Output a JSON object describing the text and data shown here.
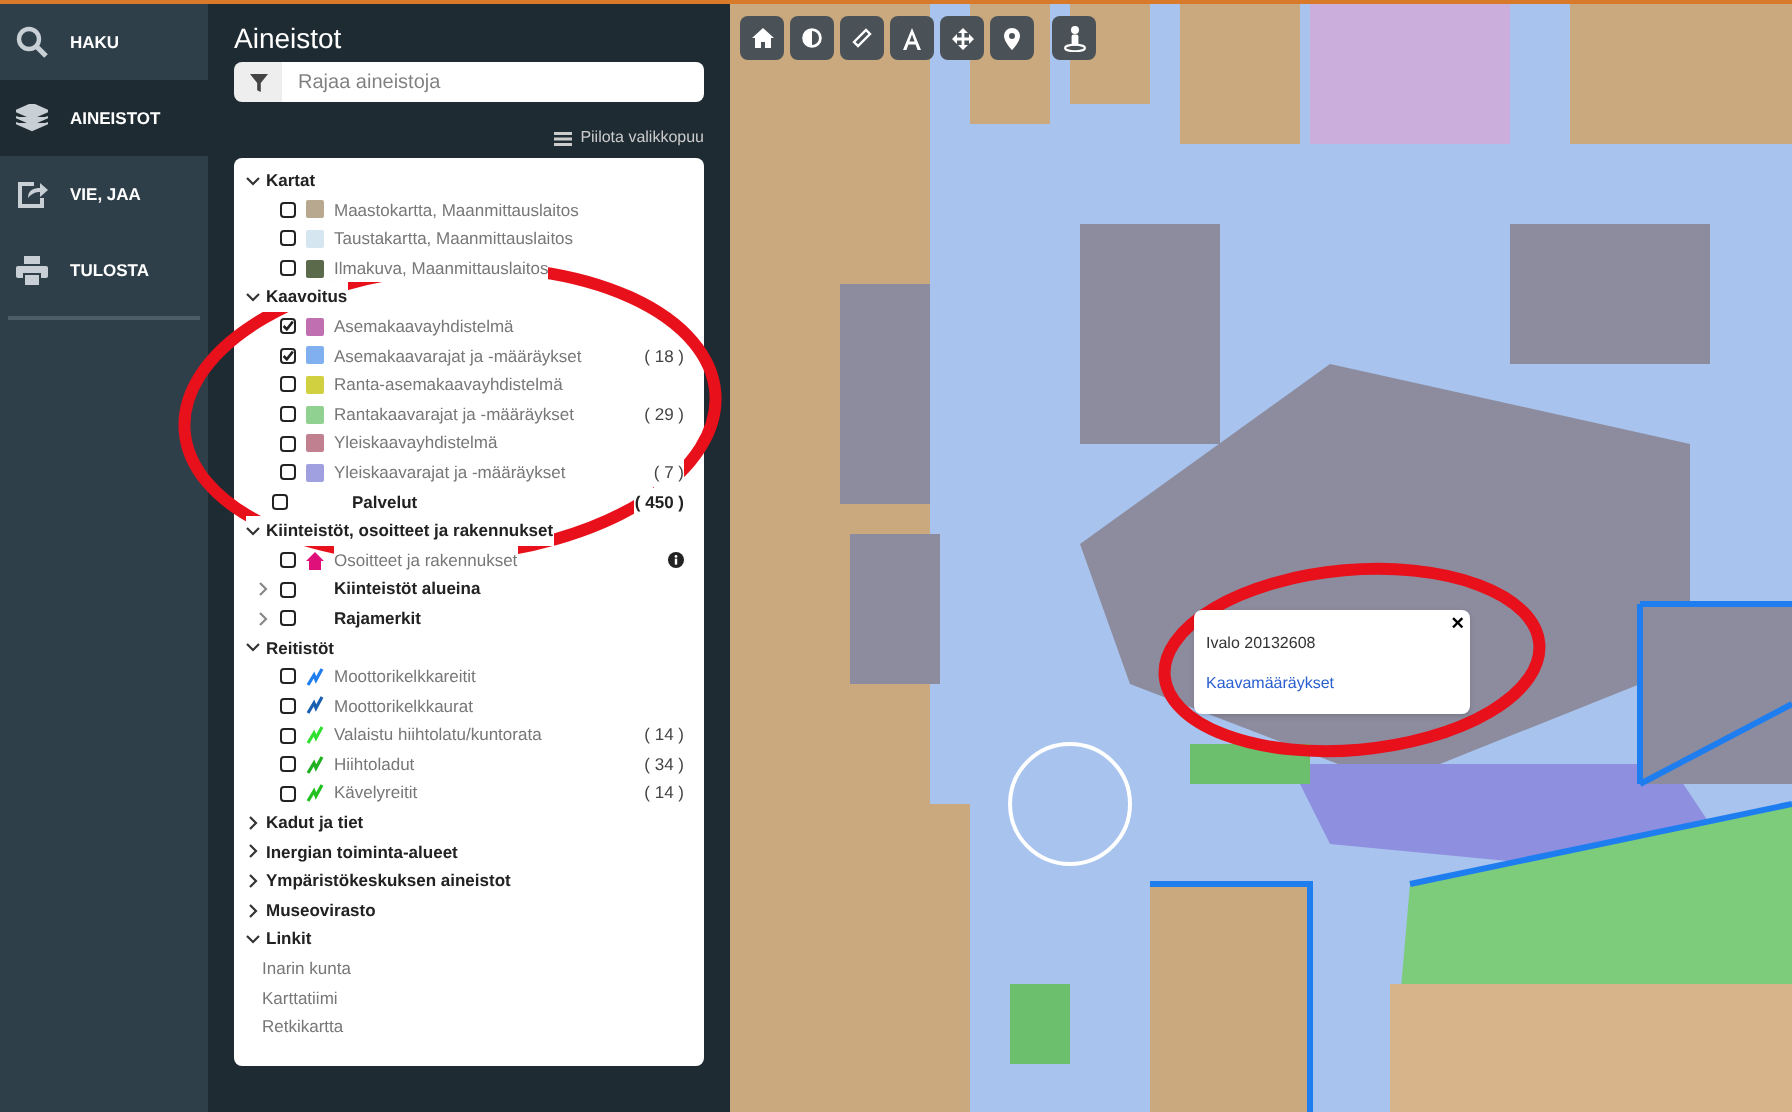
{
  "nav": [
    {
      "label": "HAKU",
      "selected": false
    },
    {
      "label": "AINEISTOT",
      "selected": true
    },
    {
      "label": "VIE, JAA",
      "selected": false
    },
    {
      "label": "TULOSTA",
      "selected": false
    }
  ],
  "panel": {
    "title": "Aineistot",
    "filter": {
      "placeholder": "Rajaa aineistoja"
    },
    "toggle": "Piilota valikkopuu"
  },
  "tree": [
    {
      "label": "Kartat",
      "expanded": true,
      "children": [
        {
          "kind": "layer",
          "label": "Maastokartta, Maanmittauslaitos",
          "checked": false,
          "color": "#b9a890"
        },
        {
          "kind": "layer",
          "label": "Taustakartta, Maanmittauslaitos",
          "checked": false,
          "color": "#d6e6f0"
        },
        {
          "kind": "layer",
          "label": "Ilmakuva, Maanmittauslaitos",
          "checked": false,
          "color": "#5a6a4a"
        }
      ]
    },
    {
      "label": "Kaavoitus",
      "expanded": true,
      "children": [
        {
          "kind": "layer",
          "label": "Asemakaavayhdistelmä",
          "checked": true,
          "color": "#c070b0"
        },
        {
          "kind": "layer",
          "label": "Asemakaavarajat ja -määräykset",
          "checked": true,
          "color": "#80b0f0",
          "count": "( 18 )"
        },
        {
          "kind": "layer",
          "label": "Ranta-asemakaavayhdistelmä",
          "checked": false,
          "color": "#d0d040"
        },
        {
          "kind": "layer",
          "label": "Rantakaavarajat ja -määräykset",
          "checked": false,
          "color": "#90d090",
          "count": "( 29 )"
        },
        {
          "kind": "layer",
          "label": "Yleiskaavayhdistelmä",
          "checked": false,
          "color": "#c08090"
        },
        {
          "kind": "layer",
          "label": "Yleiskaavarajat ja -määräykset",
          "checked": false,
          "color": "#a0a0e0",
          "count": "( 7 )"
        }
      ]
    },
    {
      "kind": "service",
      "label": "Palvelut",
      "checked": false,
      "count": "( 450 )"
    },
    {
      "label": "Kiinteistöt, osoitteet ja rakennukset",
      "expanded": true,
      "children": [
        {
          "kind": "layer",
          "label": "Osoitteet ja rakennukset",
          "checked": false,
          "color": "#e0107a",
          "info": true
        },
        {
          "kind": "subgroup",
          "label": "Kiinteistöt alueina",
          "checked": false,
          "expanded": false
        },
        {
          "kind": "subgroup",
          "label": "Rajamerkit",
          "checked": false,
          "expanded": false
        }
      ]
    },
    {
      "label": "Reitistöt",
      "expanded": true,
      "children": [
        {
          "kind": "route",
          "label": "Moottorikelkkareitit",
          "checked": false,
          "color": "#1e7ef0"
        },
        {
          "kind": "route",
          "label": "Moottorikelkkaurat",
          "checked": false,
          "color": "#1a5fb0"
        },
        {
          "kind": "route",
          "label": "Valaistu hiihtolatu/kuntorata",
          "checked": false,
          "color": "#30e030",
          "count": "( 14 )"
        },
        {
          "kind": "route",
          "label": "Hiihtoladut",
          "checked": false,
          "color": "#20b020",
          "count": "( 34 )"
        },
        {
          "kind": "route",
          "label": "Kävelyreitit",
          "checked": false,
          "color": "#20c020",
          "count": "( 14 )"
        }
      ]
    },
    {
      "label": "Kadut ja tiet",
      "expanded": false
    },
    {
      "label": "Inergian toiminta-alueet",
      "expanded": false
    },
    {
      "label": "Ympäristökeskuksen aineistot",
      "expanded": false
    },
    {
      "label": "Museovirasto",
      "expanded": false
    },
    {
      "label": "Linkit",
      "expanded": true,
      "children": [
        {
          "kind": "link",
          "label": "Inarin kunta"
        },
        {
          "kind": "link",
          "label": "Karttatiimi"
        },
        {
          "kind": "link",
          "label": "Retkikartta"
        }
      ]
    }
  ],
  "popup": {
    "title": "Ivalo 20132608",
    "link": "Kaavamääräykset",
    "close": "×"
  }
}
